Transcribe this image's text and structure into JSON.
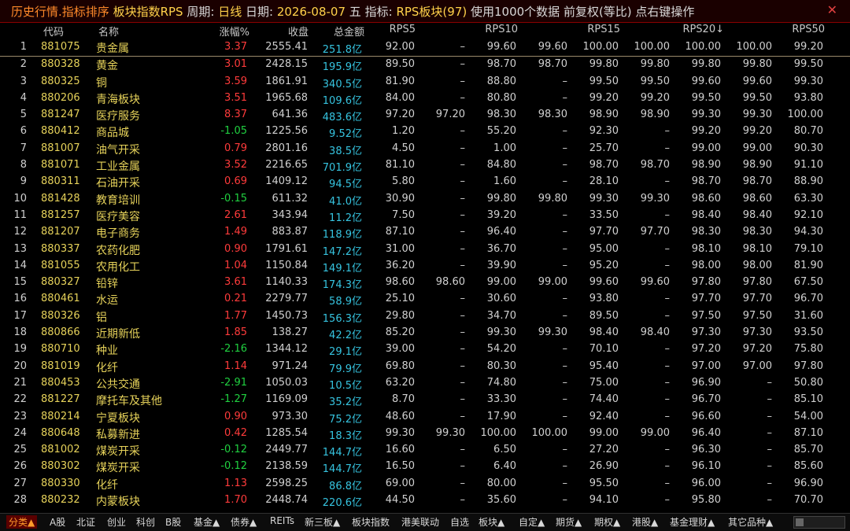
{
  "titlebar": {
    "part1": "历史行情.指标排序",
    "part2": "板块指数RPS",
    "part3": "周期:",
    "period": "日线",
    "part4": "日期:",
    "date": "2026-08-07",
    "weekday": "五",
    "part5": "指标:",
    "indicator": "RPS板块(97)",
    "part6": "使用1000个数据 前复权(等比) 点右键操作",
    "close_symbol": "✕"
  },
  "columns": [
    "代码",
    "名称",
    "涨幅%",
    "收盘",
    "总金额",
    "RPS5",
    "RPS10",
    "RPS15",
    "RPS20↓",
    "RPS50"
  ],
  "rows": [
    {
      "i": "1",
      "code": "881075",
      "name": "贵金属",
      "chg": "3.37",
      "close": "2555.41",
      "amt": "251.8亿",
      "r": [
        "92.00",
        "–",
        "99.60",
        "99.60",
        "100.00",
        "100.00",
        "100.00",
        "100.00",
        "99.20"
      ]
    },
    {
      "i": "2",
      "code": "880328",
      "name": "黄金",
      "chg": "3.01",
      "close": "2428.15",
      "amt": "195.9亿",
      "r": [
        "89.50",
        "–",
        "98.70",
        "98.70",
        "99.80",
        "99.80",
        "99.80",
        "99.80",
        "99.50"
      ]
    },
    {
      "i": "3",
      "code": "880325",
      "name": "铜",
      "chg": "3.59",
      "close": "1861.91",
      "amt": "340.5亿",
      "r": [
        "81.90",
        "–",
        "88.80",
        "–",
        "99.50",
        "99.50",
        "99.60",
        "99.60",
        "99.30"
      ]
    },
    {
      "i": "4",
      "code": "880206",
      "name": "青海板块",
      "chg": "3.51",
      "close": "1965.68",
      "amt": "109.6亿",
      "r": [
        "84.00",
        "–",
        "80.80",
        "–",
        "99.20",
        "99.20",
        "99.50",
        "99.50",
        "93.80"
      ]
    },
    {
      "i": "5",
      "code": "881247",
      "name": "医疗服务",
      "chg": "8.37",
      "close": "641.36",
      "amt": "483.6亿",
      "r": [
        "97.20",
        "97.20",
        "98.30",
        "98.30",
        "98.90",
        "98.90",
        "99.30",
        "99.30",
        "100.00"
      ]
    },
    {
      "i": "6",
      "code": "880412",
      "name": "商品城",
      "chg": "-1.05",
      "close": "1225.56",
      "amt": "9.52亿",
      "r": [
        "1.20",
        "–",
        "55.20",
        "–",
        "92.30",
        "–",
        "99.20",
        "99.20",
        "80.70"
      ]
    },
    {
      "i": "7",
      "code": "881007",
      "name": "油气开采",
      "chg": "0.79",
      "close": "2801.16",
      "amt": "38.5亿",
      "r": [
        "4.50",
        "–",
        "1.00",
        "–",
        "25.70",
        "–",
        "99.00",
        "99.00",
        "90.30"
      ]
    },
    {
      "i": "8",
      "code": "881071",
      "name": "工业金属",
      "chg": "3.52",
      "close": "2216.65",
      "amt": "701.9亿",
      "r": [
        "81.10",
        "–",
        "84.80",
        "–",
        "98.70",
        "98.70",
        "98.90",
        "98.90",
        "91.10"
      ]
    },
    {
      "i": "9",
      "code": "880311",
      "name": "石油开采",
      "chg": "0.69",
      "close": "1409.12",
      "amt": "94.5亿",
      "r": [
        "5.80",
        "–",
        "1.60",
        "–",
        "28.10",
        "–",
        "98.70",
        "98.70",
        "88.90"
      ]
    },
    {
      "i": "10",
      "code": "881428",
      "name": "教育培训",
      "chg": "-0.15",
      "close": "611.32",
      "amt": "41.0亿",
      "r": [
        "30.90",
        "–",
        "99.80",
        "99.80",
        "99.30",
        "99.30",
        "98.60",
        "98.60",
        "63.30"
      ]
    },
    {
      "i": "11",
      "code": "881257",
      "name": "医疗美容",
      "chg": "2.61",
      "close": "343.94",
      "amt": "11.2亿",
      "r": [
        "7.50",
        "–",
        "39.20",
        "–",
        "33.50",
        "–",
        "98.40",
        "98.40",
        "92.10"
      ]
    },
    {
      "i": "12",
      "code": "881207",
      "name": "电子商务",
      "chg": "1.49",
      "close": "883.87",
      "amt": "118.9亿",
      "r": [
        "87.10",
        "–",
        "96.40",
        "–",
        "97.70",
        "97.70",
        "98.30",
        "98.30",
        "94.30"
      ]
    },
    {
      "i": "13",
      "code": "880337",
      "name": "农药化肥",
      "chg": "0.90",
      "close": "1791.61",
      "amt": "147.2亿",
      "r": [
        "31.00",
        "–",
        "36.70",
        "–",
        "95.00",
        "–",
        "98.10",
        "98.10",
        "79.10"
      ]
    },
    {
      "i": "14",
      "code": "881055",
      "name": "农用化工",
      "chg": "1.04",
      "close": "1150.84",
      "amt": "149.1亿",
      "r": [
        "36.20",
        "–",
        "39.90",
        "–",
        "95.20",
        "–",
        "98.00",
        "98.00",
        "81.90"
      ]
    },
    {
      "i": "15",
      "code": "880327",
      "name": "铅锌",
      "chg": "3.61",
      "close": "1140.33",
      "amt": "174.3亿",
      "r": [
        "98.60",
        "98.60",
        "99.00",
        "99.00",
        "99.60",
        "99.60",
        "97.80",
        "97.80",
        "67.50"
      ]
    },
    {
      "i": "16",
      "code": "880461",
      "name": "水运",
      "chg": "0.21",
      "close": "2279.77",
      "amt": "58.9亿",
      "r": [
        "25.10",
        "–",
        "30.60",
        "–",
        "93.80",
        "–",
        "97.70",
        "97.70",
        "96.70"
      ]
    },
    {
      "i": "17",
      "code": "880326",
      "name": "铝",
      "chg": "1.77",
      "close": "1450.73",
      "amt": "156.3亿",
      "r": [
        "29.80",
        "–",
        "34.70",
        "–",
        "89.50",
        "–",
        "97.50",
        "97.50",
        "31.60"
      ]
    },
    {
      "i": "18",
      "code": "880866",
      "name": "近期新低",
      "chg": "1.85",
      "close": "138.27",
      "amt": "42.2亿",
      "r": [
        "85.20",
        "–",
        "99.30",
        "99.30",
        "98.40",
        "98.40",
        "97.30",
        "97.30",
        "93.50"
      ]
    },
    {
      "i": "19",
      "code": "880710",
      "name": "种业",
      "chg": "-2.16",
      "close": "1344.12",
      "amt": "29.1亿",
      "r": [
        "39.00",
        "–",
        "54.20",
        "–",
        "70.10",
        "–",
        "97.20",
        "97.20",
        "75.80"
      ]
    },
    {
      "i": "20",
      "code": "881019",
      "name": "化纤",
      "chg": "1.14",
      "close": "971.24",
      "amt": "79.9亿",
      "r": [
        "69.80",
        "–",
        "80.30",
        "–",
        "95.40",
        "–",
        "97.00",
        "97.00",
        "97.80"
      ]
    },
    {
      "i": "21",
      "code": "880453",
      "name": "公共交通",
      "chg": "-2.91",
      "close": "1050.03",
      "amt": "10.5亿",
      "r": [
        "63.20",
        "–",
        "74.80",
        "–",
        "75.00",
        "–",
        "96.90",
        "–",
        "50.80"
      ]
    },
    {
      "i": "22",
      "code": "881227",
      "name": "摩托车及其他",
      "chg": "-1.27",
      "close": "1169.09",
      "amt": "35.2亿",
      "r": [
        "8.70",
        "–",
        "33.30",
        "–",
        "74.40",
        "–",
        "96.70",
        "–",
        "85.10"
      ]
    },
    {
      "i": "23",
      "code": "880214",
      "name": "宁夏板块",
      "chg": "0.90",
      "close": "973.30",
      "amt": "75.2亿",
      "r": [
        "48.60",
        "–",
        "17.90",
        "–",
        "92.40",
        "–",
        "96.60",
        "–",
        "54.00"
      ]
    },
    {
      "i": "24",
      "code": "880648",
      "name": "私募新进",
      "chg": "0.42",
      "close": "1285.54",
      "amt": "18.3亿",
      "r": [
        "99.30",
        "99.30",
        "100.00",
        "100.00",
        "99.00",
        "99.00",
        "96.40",
        "–",
        "87.10"
      ]
    },
    {
      "i": "25",
      "code": "881002",
      "name": "煤炭开采",
      "chg": "-0.12",
      "close": "2449.77",
      "amt": "144.7亿",
      "r": [
        "16.60",
        "–",
        "6.50",
        "–",
        "27.20",
        "–",
        "96.30",
        "–",
        "85.70"
      ]
    },
    {
      "i": "26",
      "code": "880302",
      "name": "煤炭开采",
      "chg": "-0.12",
      "close": "2138.59",
      "amt": "144.7亿",
      "r": [
        "16.50",
        "–",
        "6.40",
        "–",
        "26.90",
        "–",
        "96.10",
        "–",
        "85.60"
      ]
    },
    {
      "i": "27",
      "code": "880330",
      "name": "化纤",
      "chg": "1.13",
      "close": "2598.25",
      "amt": "86.8亿",
      "r": [
        "69.00",
        "–",
        "80.00",
        "–",
        "95.50",
        "–",
        "96.00",
        "–",
        "96.90"
      ]
    },
    {
      "i": "28",
      "code": "880232",
      "name": "内蒙板块",
      "chg": "1.70",
      "close": "2448.74",
      "amt": "220.6亿",
      "r": [
        "44.50",
        "–",
        "35.60",
        "–",
        "94.10",
        "–",
        "95.80",
        "–",
        "70.70"
      ]
    }
  ],
  "tabs": [
    "分类▲",
    "A股",
    "北证",
    "创业",
    "科创",
    "B股",
    "基金▲",
    "债券▲",
    "REITs",
    "新三板▲",
    "板块指数",
    "港美联动",
    "自选",
    "板块▲",
    "自定▲",
    "期货▲",
    "期权▲",
    "港股▲",
    "基金理财▲",
    "其它品种▲"
  ]
}
